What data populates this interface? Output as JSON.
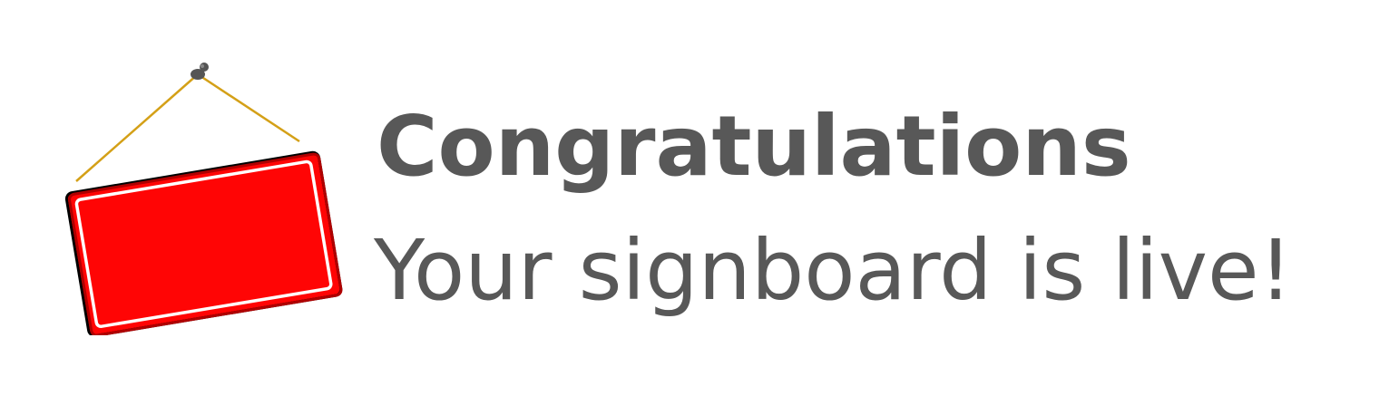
{
  "message": {
    "title": "Congratulations",
    "subtitle": "Your signboard is live!"
  },
  "illustration": {
    "icon": "hanging-signboard-icon",
    "board_color": "#ff0505",
    "frame_color": "#b00000",
    "string_color": "#d4a017",
    "pin_color": "#555555"
  },
  "text_color": "#585858"
}
